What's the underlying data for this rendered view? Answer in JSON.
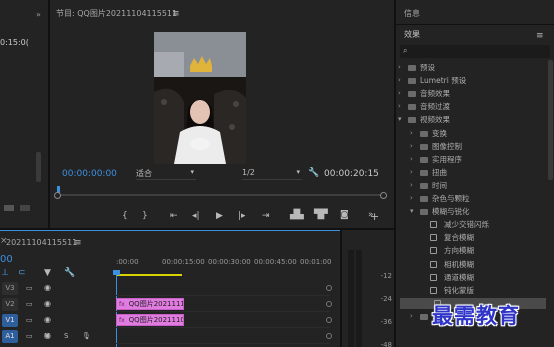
{
  "source_panel": {
    "timecode_fragment": "0:15:0("
  },
  "program": {
    "title": "节目: QQ图片20211104115511",
    "timecode": "00:00:00:00",
    "fit_label": "适合",
    "resolution": "1/2",
    "duration": "00:00:20:15"
  },
  "effects_panel": {
    "info_tab": "信息",
    "title": "效果",
    "search_placeholder": "",
    "items": [
      {
        "label": "预设",
        "level": 0,
        "type": "folder"
      },
      {
        "label": "Lumetri 预设",
        "level": 0,
        "type": "folder"
      },
      {
        "label": "音频效果",
        "level": 0,
        "type": "folder"
      },
      {
        "label": "音频过渡",
        "level": 0,
        "type": "folder"
      },
      {
        "label": "视频效果",
        "level": 0,
        "type": "folder-open"
      },
      {
        "label": "变换",
        "level": 1,
        "type": "folder"
      },
      {
        "label": "图像控制",
        "level": 1,
        "type": "folder"
      },
      {
        "label": "实用程序",
        "level": 1,
        "type": "folder"
      },
      {
        "label": "扭曲",
        "level": 1,
        "type": "folder"
      },
      {
        "label": "时间",
        "level": 1,
        "type": "folder"
      },
      {
        "label": "杂色与颗粒",
        "level": 1,
        "type": "folder"
      },
      {
        "label": "模糊与锐化",
        "level": 1,
        "type": "folder-open"
      },
      {
        "label": "减少交错闪烁",
        "level": 2,
        "type": "file"
      },
      {
        "label": "复合模糊",
        "level": 2,
        "type": "file"
      },
      {
        "label": "方向模糊",
        "level": 2,
        "type": "file"
      },
      {
        "label": "相机模糊",
        "level": 2,
        "type": "file"
      },
      {
        "label": "通道模糊",
        "level": 2,
        "type": "file"
      },
      {
        "label": "钝化蒙版",
        "level": 2,
        "type": "file"
      },
      {
        "label": "",
        "level": 2,
        "type": "file-selected"
      },
      {
        "label": "沉浸式视频",
        "level": 1,
        "type": "folder"
      }
    ]
  },
  "timeline": {
    "sequence_name": "20211104115511",
    "timecode": "00",
    "ruler": [
      ":00:00",
      "00:00:15:00",
      "00:00:30:00",
      "00:00:45:00",
      "00:01:00"
    ],
    "tracks": [
      {
        "name": "V3",
        "clip": ""
      },
      {
        "name": "V2",
        "clip": "QQ图片2021111"
      },
      {
        "name": "V1",
        "clip": "QQ图片2021110"
      },
      {
        "name": "A1",
        "clip": ""
      }
    ],
    "track_letters": [
      "M",
      "S"
    ]
  },
  "meter": {
    "ticks": [
      "-12",
      "-24",
      "-36",
      "-48"
    ]
  },
  "watermark": "最需教育",
  "colors": {
    "accent": "#3d8fe0",
    "clip": "#e07be0",
    "panel": "#232323",
    "watermark": "#2f35c8"
  }
}
